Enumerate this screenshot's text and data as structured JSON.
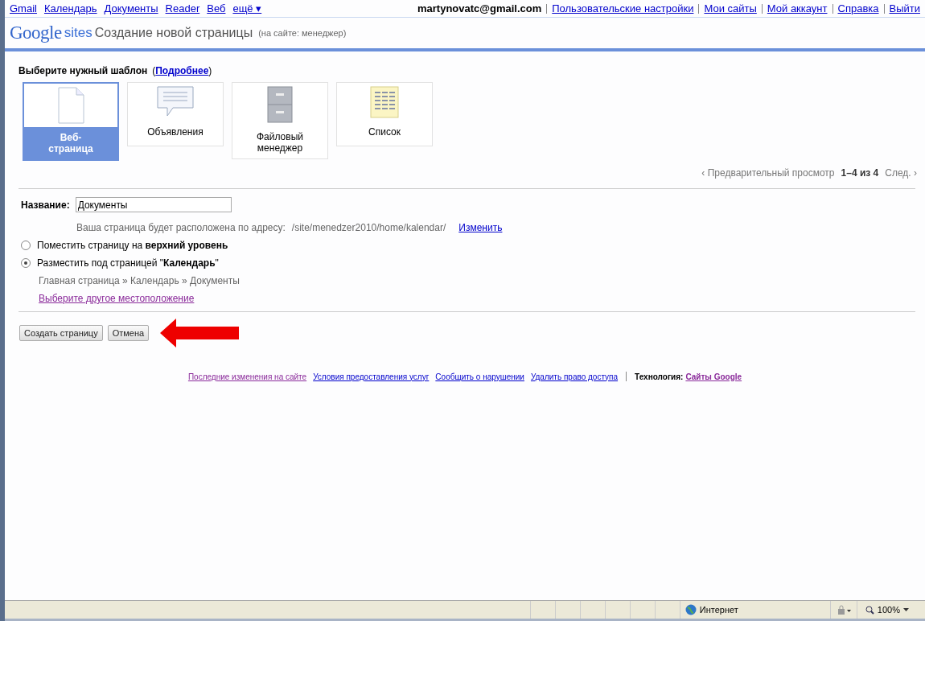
{
  "top_links": [
    {
      "label": "Gmail"
    },
    {
      "label": "Календарь"
    },
    {
      "label": "Документы"
    },
    {
      "label": "Reader"
    },
    {
      "label": "Веб"
    },
    {
      "label": "ещё ▾"
    }
  ],
  "account": {
    "email": "martynovatc@gmail.com",
    "links": [
      "Пользовательские настройки",
      "Мои сайты",
      "Мой аккаунт",
      "Справка",
      "Выйти"
    ]
  },
  "header": {
    "logo_word": "Google",
    "logo_suffix": "sites",
    "title": "Создание новой страницы",
    "subtitle": "(на сайте: менеджер)"
  },
  "template_section": {
    "heading": "Выберите нужный шаблон",
    "paren_open": "(",
    "more_link": "Подробнее",
    "paren_close": ")"
  },
  "templates": [
    {
      "kind": "page",
      "label": "Веб-страница",
      "selected": true
    },
    {
      "kind": "announcements",
      "label": "Объявления",
      "selected": false
    },
    {
      "kind": "filecabinet",
      "label": "Файловый менеджер",
      "selected": false
    },
    {
      "kind": "list",
      "label": "Список",
      "selected": false
    }
  ],
  "pager": {
    "preview": "‹ Предварительный просмотр",
    "range": "1–4 из 4",
    "next": "След. ›"
  },
  "name_field": {
    "label": "Название:",
    "value": "Документы"
  },
  "address": {
    "prefix": "Ваша страница будет расположена по адресу:",
    "path": "/site/menedzer2010/home/kalendar/",
    "change_link": "Изменить"
  },
  "placement": [
    {
      "label": "Поместить страницу на **верхний уровень**",
      "selected": false
    },
    {
      "label": "Разместить под страницей \"**Календарь**\"",
      "selected": true
    }
  ],
  "breadcrumb": "Главная страница » Календарь » Документы",
  "other_location_link": "Выберите другое местоположение",
  "buttons": [
    "Создать страницу",
    "Отмена"
  ],
  "footer": {
    "links": [
      {
        "label": "Последние изменения на сайте",
        "visited": true
      },
      {
        "label": "Условия предоставления услуг",
        "visited": false
      },
      {
        "label": "Сообщить о нарушении",
        "visited": false
      },
      {
        "label": "Удалить право доступа",
        "visited": false
      }
    ],
    "tech_label": "Технология:",
    "tech_link": "Сайты Google"
  },
  "status_bar": {
    "zone": "Интернет",
    "zoom": "100%"
  }
}
